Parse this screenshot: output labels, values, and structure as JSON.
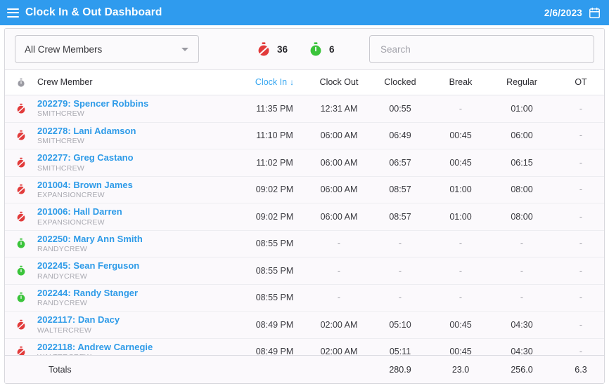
{
  "appbar": {
    "menu_icon": "hamburger-menu-icon",
    "title": "Clock In & Out Dashboard",
    "date": "2/6/2023",
    "calendar_icon": "calendar-icon"
  },
  "toolbar": {
    "crew_filter": {
      "selected": "All Crew Members",
      "dropdown_icon": "chevron-down-icon"
    },
    "counters": [
      {
        "icon": "stopwatch-off-icon",
        "color": "#e23b3b",
        "value": "36"
      },
      {
        "icon": "stopwatch-on-icon",
        "color": "#3bc43b",
        "value": "6"
      }
    ],
    "search": {
      "value": "",
      "placeholder": "Search"
    }
  },
  "table": {
    "header_icon": "stopwatch-icon",
    "columns": [
      {
        "key": "clock_in",
        "label": "Clock In",
        "sorted": true,
        "sort_icon": "↓"
      },
      {
        "key": "clock_out",
        "label": "Clock Out",
        "sorted": false
      },
      {
        "key": "clocked",
        "label": "Clocked",
        "sorted": false
      },
      {
        "key": "break",
        "label": "Break",
        "sorted": false
      },
      {
        "key": "regular",
        "label": "Regular",
        "sorted": false
      },
      {
        "key": "ot",
        "label": "OT",
        "sorted": false
      }
    ],
    "name_column": "Crew Member",
    "rows": [
      {
        "status": "off",
        "name": "202279: Spencer Robbins",
        "crew": "SMITHCREW",
        "clock_in": "11:35 PM",
        "clock_out": "12:31 AM",
        "clocked": "00:55",
        "break": "-",
        "regular": "01:00",
        "ot": "-"
      },
      {
        "status": "off",
        "name": "202278: Lani Adamson",
        "crew": "SMITHCREW",
        "clock_in": "11:10 PM",
        "clock_out": "06:00 AM",
        "clocked": "06:49",
        "break": "00:45",
        "regular": "06:00",
        "ot": "-"
      },
      {
        "status": "off",
        "name": "202277: Greg Castano",
        "crew": "SMITHCREW",
        "clock_in": "11:02 PM",
        "clock_out": "06:00 AM",
        "clocked": "06:57",
        "break": "00:45",
        "regular": "06:15",
        "ot": "-"
      },
      {
        "status": "off",
        "name": "201004: Brown James",
        "crew": "EXPANSIONCREW",
        "clock_in": "09:02 PM",
        "clock_out": "06:00 AM",
        "clocked": "08:57",
        "break": "01:00",
        "regular": "08:00",
        "ot": "-"
      },
      {
        "status": "off",
        "name": "201006: Hall Darren",
        "crew": "EXPANSIONCREW",
        "clock_in": "09:02 PM",
        "clock_out": "06:00 AM",
        "clocked": "08:57",
        "break": "01:00",
        "regular": "08:00",
        "ot": "-"
      },
      {
        "status": "on",
        "name": "202250: Mary Ann Smith",
        "crew": "RANDYCREW",
        "clock_in": "08:55 PM",
        "clock_out": "-",
        "clocked": "-",
        "break": "-",
        "regular": "-",
        "ot": "-"
      },
      {
        "status": "on",
        "name": "202245: Sean Ferguson",
        "crew": "RANDYCREW",
        "clock_in": "08:55 PM",
        "clock_out": "-",
        "clocked": "-",
        "break": "-",
        "regular": "-",
        "ot": "-"
      },
      {
        "status": "on",
        "name": "202244: Randy Stanger",
        "crew": "RANDYCREW",
        "clock_in": "08:55 PM",
        "clock_out": "-",
        "clocked": "-",
        "break": "-",
        "regular": "-",
        "ot": "-"
      },
      {
        "status": "off",
        "name": "2022117: Dan Dacy",
        "crew": "WALTERCREW",
        "clock_in": "08:49 PM",
        "clock_out": "02:00 AM",
        "clocked": "05:10",
        "break": "00:45",
        "regular": "04:30",
        "ot": "-"
      },
      {
        "status": "off",
        "name": "2022118: Andrew Carnegie",
        "crew": "WALTERCREW",
        "clock_in": "08:49 PM",
        "clock_out": "02:00 AM",
        "clocked": "05:11",
        "break": "00:45",
        "regular": "04:30",
        "ot": "-"
      }
    ],
    "totals": {
      "label": "Totals",
      "clock_in": "",
      "clock_out": "",
      "clocked": "280.9",
      "break": "23.0",
      "regular": "256.0",
      "ot": "6.3"
    }
  },
  "colors": {
    "appbar": "#2f9bee",
    "link": "#2e9be8",
    "status_off": "#e23b3b",
    "status_on": "#3bc43b"
  }
}
